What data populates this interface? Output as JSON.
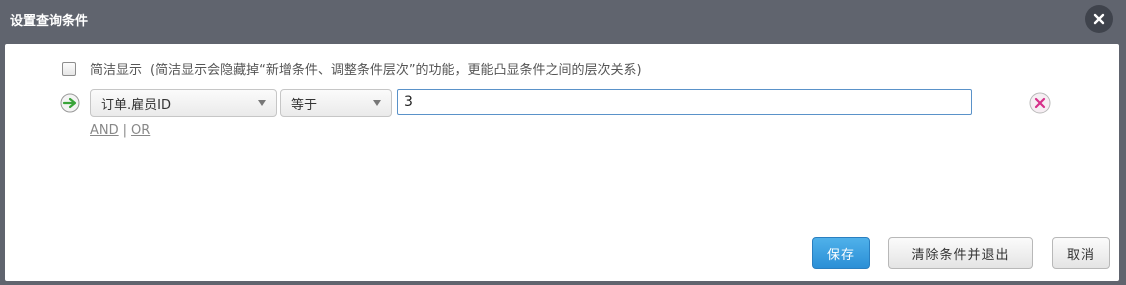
{
  "dialog": {
    "title": "设置查询条件"
  },
  "simple_display": {
    "label": "简洁显示",
    "note": "(简洁显示会隐藏掉“新增条件、调整条件层次”的功能，更能凸显条件之间的层次关系)",
    "checked": false
  },
  "condition": {
    "field": "订单.雇员ID",
    "operator": "等于",
    "value": "3"
  },
  "logic": {
    "and_label": "AND",
    "separator": "|",
    "or_label": "OR"
  },
  "buttons": {
    "save_label": "保存",
    "clear_exit_label": "清除条件并退出",
    "cancel_label": "取消"
  },
  "icons": {
    "close": "close-icon",
    "add": "add-condition-arrow-icon",
    "remove": "remove-condition-icon"
  },
  "colors": {
    "titlebar": "#60646e",
    "save_button": "#3a9fe0",
    "input_border": "#5a92c9",
    "remove_icon": "#d6308a",
    "add_icon": "#3aa43a"
  }
}
